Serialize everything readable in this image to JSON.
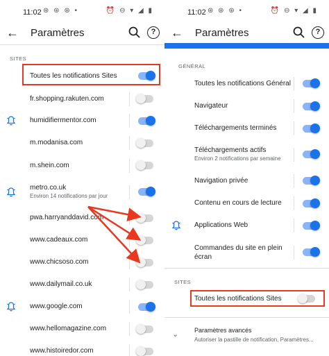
{
  "status": {
    "time": "11:02",
    "left_icons": "⊛ ⊛ ⊛ •",
    "right_icons": "⏰ ⊖ ▾ ◢ ▮"
  },
  "colors": {
    "accent": "#1a73e8",
    "highlight": "#e8381f",
    "arrow": "#e8381f"
  },
  "left": {
    "title": "Paramètres",
    "section_sites": "SITES",
    "rows": [
      {
        "label": "Toutes les notifications Sites",
        "toggle": "on",
        "bell": false,
        "highlighted": true
      },
      {
        "label": "fr.shopping.rakuten.com",
        "toggle": "off",
        "bell": false
      },
      {
        "label": "humidifiermentor.com",
        "toggle": "on",
        "bell": true
      },
      {
        "label": "m.modanisa.com",
        "toggle": "off",
        "bell": false
      },
      {
        "label": "m.shein.com",
        "toggle": "off",
        "bell": false
      },
      {
        "label": "metro.co.uk",
        "sub": "Environ 14 notifications par jour",
        "toggle": "on",
        "bell": true
      },
      {
        "label": "pwa.harryanddavid.com",
        "toggle": "off",
        "bell": false
      },
      {
        "label": "www.cadeaux.com",
        "toggle": "off",
        "bell": false
      },
      {
        "label": "www.chicsoso.com",
        "toggle": "off",
        "bell": false
      },
      {
        "label": "www.dailymail.co.uk",
        "toggle": "off",
        "bell": false
      },
      {
        "label": "www.google.com",
        "toggle": "on",
        "bell": true
      },
      {
        "label": "www.hellomagazine.com",
        "toggle": "off",
        "bell": false
      },
      {
        "label": "www.histoiredor.com",
        "toggle": "off",
        "bell": false
      }
    ]
  },
  "right": {
    "title": "Paramètres",
    "section_general": "GÉNÉRAL",
    "section_sites": "SITES",
    "rows": [
      {
        "label": "Toutes les notifications Général",
        "toggle": "on"
      },
      {
        "label": "Navigateur",
        "toggle": "on"
      },
      {
        "label": "Téléchargements terminés",
        "toggle": "on"
      },
      {
        "label": "Téléchargements actifs",
        "sub": "Environ 2 notifications par semaine",
        "toggle": "on"
      },
      {
        "label": "Navigation privée",
        "toggle": "on"
      },
      {
        "label": "Contenu en cours de lecture",
        "toggle": "on"
      },
      {
        "label": "Applications Web",
        "toggle": "on",
        "bell": true
      },
      {
        "label": "Commandes du site en plein",
        "label2": "écran",
        "toggle": "on"
      }
    ],
    "sites_row": {
      "label": "Toutes les notifications Sites",
      "toggle": "off"
    },
    "advanced": {
      "label": "Paramètres avancés",
      "sub": "Autoriser la pastille de notification, Paramètres..."
    }
  }
}
